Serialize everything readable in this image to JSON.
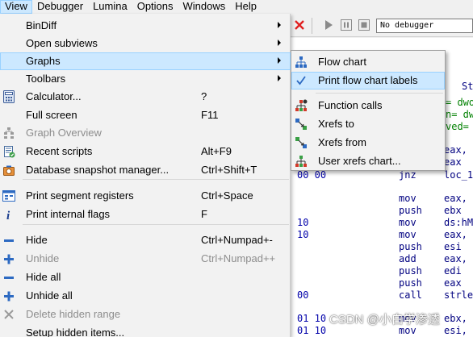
{
  "menubar": {
    "items": [
      "View",
      "Debugger",
      "Lumina",
      "Options",
      "Windows",
      "Help"
    ]
  },
  "toolbar": {
    "debugger_select": "No debugger"
  },
  "view_menu": {
    "items": [
      {
        "label": "BinDiff",
        "shortcut": "",
        "icon": "none",
        "submenu": true
      },
      {
        "label": "Open subviews",
        "shortcut": "",
        "icon": "none",
        "submenu": true
      },
      {
        "label": "Graphs",
        "shortcut": "",
        "icon": "none",
        "submenu": true
      },
      {
        "label": "Toolbars",
        "shortcut": "",
        "icon": "none",
        "submenu": true
      },
      {
        "label": "Calculator...",
        "shortcut": "?",
        "icon": "calculator-icon"
      },
      {
        "label": "Full screen",
        "shortcut": "F11",
        "icon": "none"
      },
      {
        "label": "Graph Overview",
        "shortcut": "",
        "icon": "graph-overview-icon"
      },
      {
        "label": "Recent scripts",
        "shortcut": "Alt+F9",
        "icon": "script-icon"
      },
      {
        "label": "Database snapshot manager...",
        "shortcut": "Ctrl+Shift+T",
        "icon": "snapshot-icon"
      },
      {
        "label": "Print segment registers",
        "shortcut": "Ctrl+Space",
        "icon": "segment-registers-icon"
      },
      {
        "label": "Print internal flags",
        "shortcut": "F",
        "icon": "info-icon"
      },
      {
        "label": "Hide",
        "shortcut": "Ctrl+Numpad+-",
        "icon": "minus-icon"
      },
      {
        "label": "Unhide",
        "shortcut": "Ctrl+Numpad++",
        "icon": "plus-icon"
      },
      {
        "label": "Hide all",
        "shortcut": "",
        "icon": "minus-icon"
      },
      {
        "label": "Unhide all",
        "shortcut": "",
        "icon": "plus-icon"
      },
      {
        "label": "Delete hidden range",
        "shortcut": "",
        "icon": "delete-icon"
      },
      {
        "label": "Setup hidden items...",
        "shortcut": "",
        "icon": "none"
      }
    ]
  },
  "graphs_submenu": {
    "items": [
      {
        "label": "Flow chart",
        "icon": "flow-chart-icon"
      },
      {
        "label": "Print flow chart labels",
        "icon": "checkmark-icon"
      },
      {
        "label": "Function calls",
        "icon": "function-calls-icon"
      },
      {
        "label": "Xrefs to",
        "icon": "xrefs-to-icon"
      },
      {
        "label": "Xrefs from",
        "icon": "xrefs-from-icon"
      },
      {
        "label": "User xrefs chart...",
        "icon": "user-xrefs-icon"
      }
    ]
  },
  "disasm": {
    "lines": [
      {
        "addr": "",
        "mnem": "",
        "ops": "St"
      },
      {
        "addr": "",
        "mnem": "",
        "ops": "= dwo"
      },
      {
        "addr": "",
        "mnem": "",
        "ops": "n= dw"
      },
      {
        "addr": "",
        "mnem": "",
        "ops": "ved= "
      },
      {
        "addr": "",
        "mnem": "",
        "ops": "eax,"
      },
      {
        "addr": "",
        "mnem": "",
        "ops": "eax"
      },
      {
        "addr": "00 00",
        "mnem": "jnz",
        "ops": "loc_1"
      },
      {
        "addr": "",
        "mnem": "mov",
        "ops": "eax,"
      },
      {
        "addr": "",
        "mnem": "push",
        "ops": "ebx"
      },
      {
        "addr": "10",
        "mnem": "mov",
        "ops": "ds:hM"
      },
      {
        "addr": "10",
        "mnem": "mov",
        "ops": "eax,"
      },
      {
        "addr": "",
        "mnem": "push",
        "ops": "esi"
      },
      {
        "addr": "",
        "mnem": "add",
        "ops": "eax,"
      },
      {
        "addr": "",
        "mnem": "push",
        "ops": "edi"
      },
      {
        "addr": "",
        "mnem": "push",
        "ops": "eax"
      },
      {
        "addr": "00",
        "mnem": "call",
        "ops": "strle"
      },
      {
        "addr": "01 10",
        "mnem": "mov",
        "ops": "ebx,"
      },
      {
        "addr": "01 10",
        "mnem": "mov",
        "ops": "esi,"
      }
    ]
  },
  "watermark": "CSDN @小白学渗透"
}
